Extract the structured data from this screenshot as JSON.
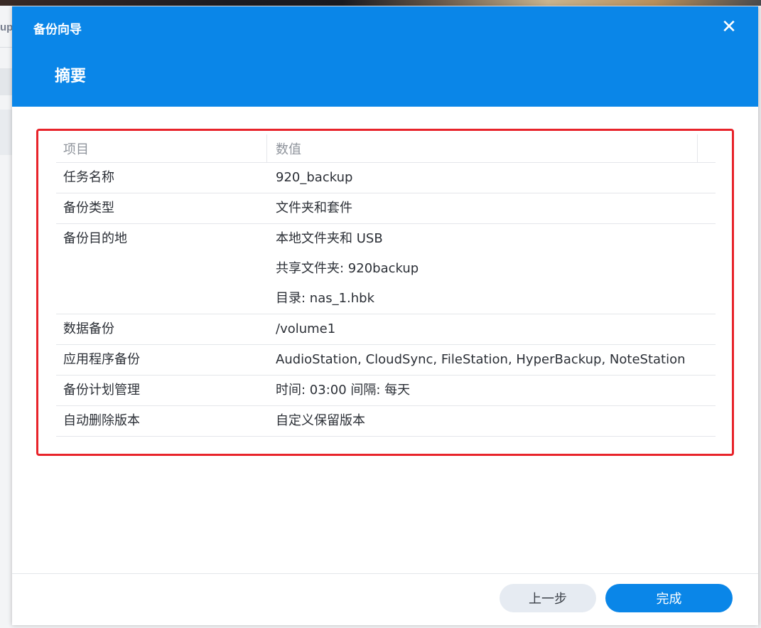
{
  "background": {
    "clipped_text": "up"
  },
  "dialog": {
    "title": "备份向导",
    "step_title": "摘要",
    "close_icon": "close-icon"
  },
  "table": {
    "headers": [
      "项目",
      "数值"
    ],
    "rows": [
      {
        "item": "任务名称",
        "values": [
          "920_backup"
        ]
      },
      {
        "item": "备份类型",
        "values": [
          "文件夹和套件"
        ]
      },
      {
        "item": "备份目的地",
        "values": [
          "本地文件夹和 USB",
          "共享文件夹: 920backup",
          "目录: nas_1.hbk"
        ]
      },
      {
        "item": "数据备份",
        "values": [
          "/volume1"
        ]
      },
      {
        "item": "应用程序备份",
        "values": [
          "AudioStation, CloudSync, FileStation, HyperBackup, NoteStation"
        ]
      },
      {
        "item": "备份计划管理",
        "values": [
          "时间: 03:00 间隔: 每天"
        ]
      },
      {
        "item": "自动删除版本",
        "values": [
          "自定义保留版本"
        ]
      }
    ]
  },
  "footer": {
    "back_label": "上一步",
    "finish_label": "完成"
  },
  "colors": {
    "accent": "#0a86e8",
    "highlight": "#e8232a"
  }
}
